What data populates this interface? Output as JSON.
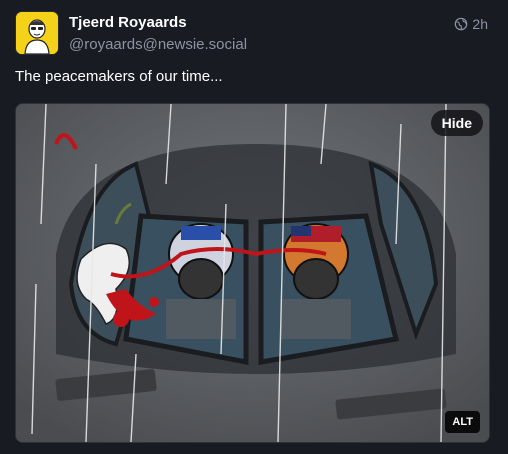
{
  "author": {
    "display_name": "Tjeerd Royaards",
    "handle": "@royaards@newsie.social",
    "avatar_icon": "avatar-cartoon-icon"
  },
  "meta": {
    "visibility_icon": "globe-icon",
    "time": "2h"
  },
  "post": {
    "text": "The peacemakers of our time..."
  },
  "media": {
    "hide_label": "Hide",
    "alt_label": "ALT"
  },
  "colors": {
    "background": "#191b22",
    "secondary_text": "#8e93a3",
    "avatar_bg": "#f4d21a",
    "blood_red": "#c0141b"
  }
}
